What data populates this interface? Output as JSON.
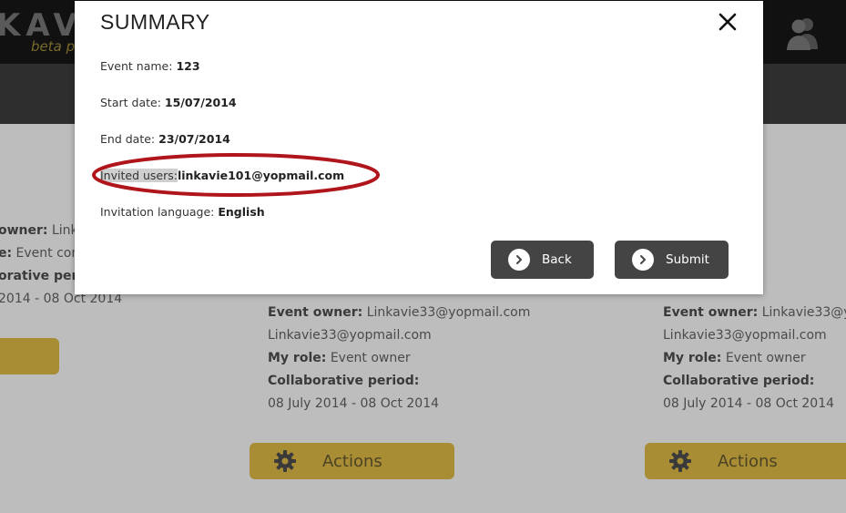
{
  "app": {
    "logo_text": "KAV",
    "logo_subtitle": "beta pr"
  },
  "cards": [
    {
      "owner_label": "owner:",
      "owner_value": "Link",
      "role_label": "e:",
      "role_value": "Event con",
      "period_label": "orative peri",
      "period_value": "2014 - 08 Oct 2014"
    },
    {
      "owner_label": "Event owner:",
      "owner_value": "Linkavie33@yopmail.com",
      "owner_line2": "Linkavie33@yopmail.com",
      "role_label": "My role:",
      "role_value": "Event owner",
      "period_label": "Collaborative period:",
      "period_value": "08 July 2014 - 08 Oct 2014",
      "actions_label": "Actions"
    },
    {
      "owner_label": "Event owner:",
      "owner_value": "Linkavie33@y",
      "owner_line2": "Linkavie33@yopmail.com",
      "role_label": "My role:",
      "role_value": "Event owner",
      "period_label": "Collaborative period:",
      "period_value": "08 July 2014 - 08 Oct 2014",
      "actions_label": "Actions"
    }
  ],
  "modal": {
    "title": "SUMMARY",
    "rows": [
      {
        "label": "Event name:",
        "value": "123"
      },
      {
        "label": "Start date:",
        "value": "15/07/2014"
      },
      {
        "label": "End date:",
        "value": "23/07/2014"
      },
      {
        "label": "Invited users:",
        "value": "linkavie101@yopmail.com"
      },
      {
        "label": "Invitation language:",
        "value": "English"
      }
    ],
    "back_label": "Back",
    "submit_label": "Submit"
  },
  "colors": {
    "annotation_ellipse": "#b0151c",
    "button_bg": "#444444",
    "actions_bg": "#a88d35"
  }
}
